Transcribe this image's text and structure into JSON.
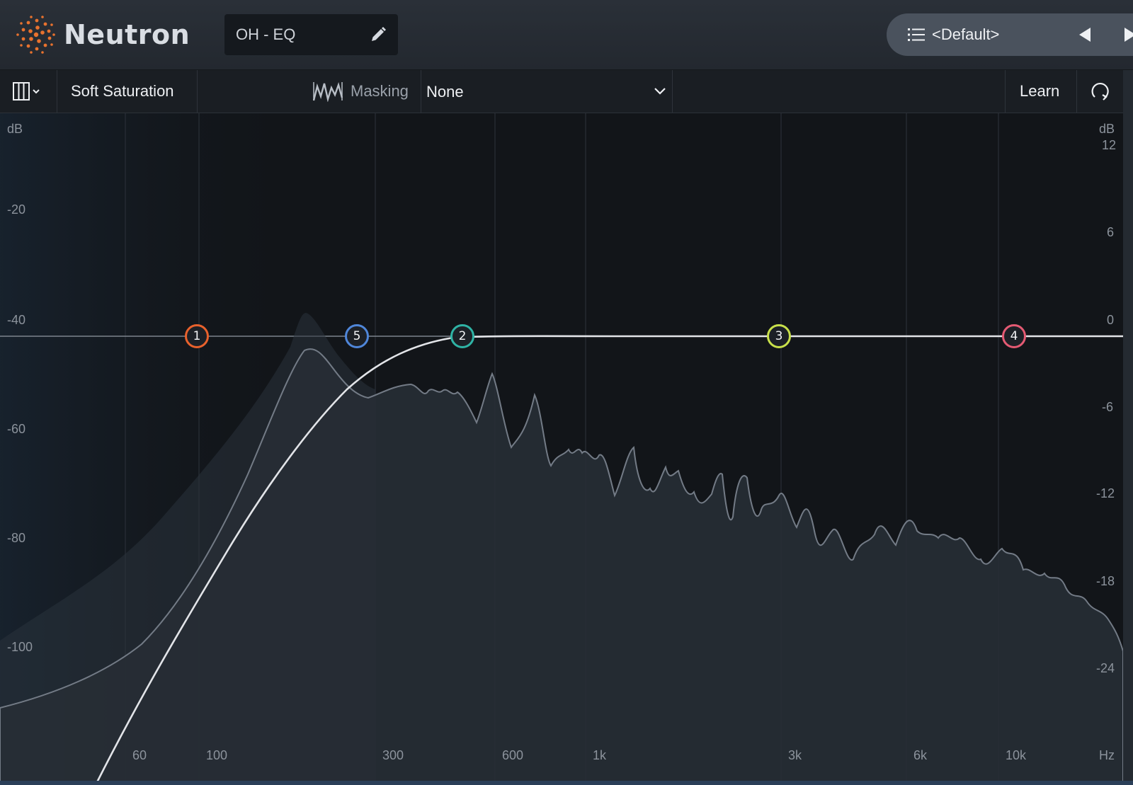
{
  "header": {
    "app_name": "Neutron",
    "preset_name": "OH - EQ",
    "preset_browser_label": "<Default>"
  },
  "toolbar": {
    "soft_saturation_label": "Soft Saturation",
    "masking_label": "Masking",
    "masking_value": "None",
    "learn_label": "Learn"
  },
  "eq": {
    "left_axis_unit": "dB",
    "right_axis_unit": "dB",
    "freq_unit": "Hz",
    "left_db_ticks": [
      "-20",
      "-40",
      "-60",
      "-80",
      "-100"
    ],
    "right_db_ticks": [
      "12",
      "6",
      "0",
      "-6",
      "-12",
      "-18",
      "-24"
    ],
    "freq_ticks": [
      "60",
      "100",
      "300",
      "600",
      "1k",
      "3k",
      "6k",
      "10k"
    ],
    "nodes": [
      {
        "label": "1",
        "color": "#e8612c"
      },
      {
        "label": "5",
        "color": "#4f86d9"
      },
      {
        "label": "2",
        "color": "#2fb3a5"
      },
      {
        "label": "3",
        "color": "#c8e04a"
      },
      {
        "label": "4",
        "color": "#e45a73"
      }
    ]
  },
  "colors": {
    "accent": "#e8612c",
    "background": "#121519"
  }
}
